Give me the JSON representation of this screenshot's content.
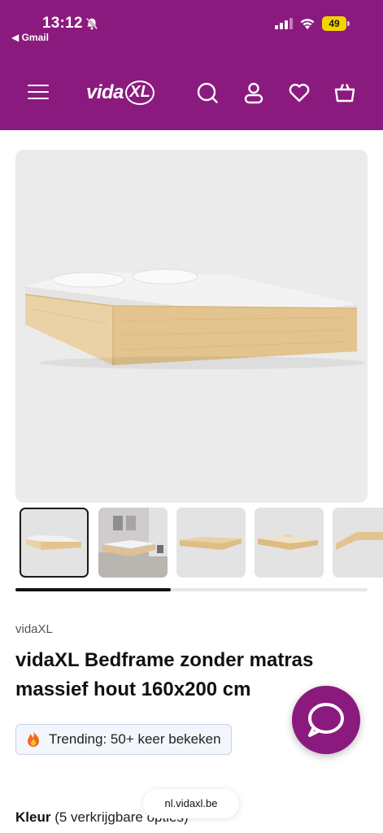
{
  "status_bar": {
    "time": "13:12",
    "back_app": "◀ Gmail",
    "battery": "49"
  },
  "header": {
    "logo_text": "vida",
    "logo_badge": "XL",
    "icons": [
      "menu-icon",
      "search-icon",
      "account-icon",
      "wishlist-icon",
      "cart-icon"
    ],
    "background": "#8b1a7e"
  },
  "gallery": {
    "thumbnail_count": 5,
    "selected_index": 0,
    "scroll_progress": 0.44
  },
  "product": {
    "brand": "vidaXL",
    "title": "vidaXL Bedframe zonder matras massief hout 160x200 cm",
    "trending": "Trending: 50+ keer bekeken",
    "color_label": "Kleur",
    "color_options": "(5 verkrijgbare opties)"
  },
  "browser": {
    "url": "nl.vidaxl.be"
  },
  "colors": {
    "brand_purple": "#8b1a7e",
    "wood": "#ead2a6",
    "trending_border": "#c9d3e6"
  }
}
